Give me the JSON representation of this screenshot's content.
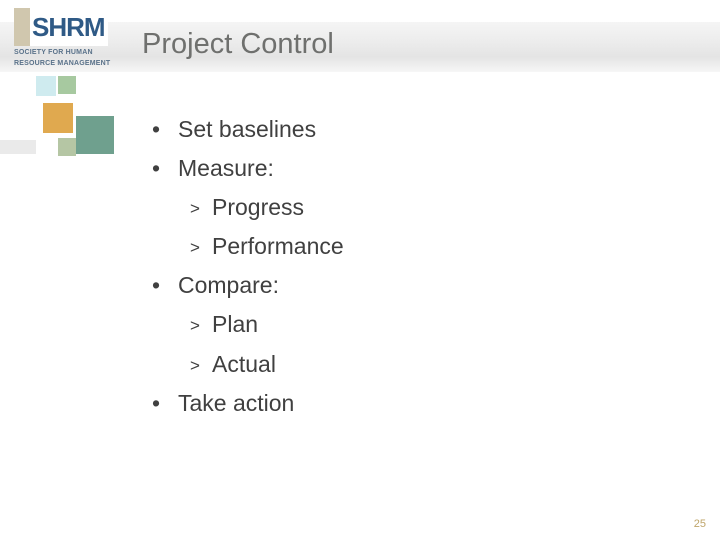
{
  "logo": {
    "letters": "SHRM",
    "sub_line1": "SOCIETY FOR HUMAN",
    "sub_line2": "RESOURCE MANAGEMENT"
  },
  "slide": {
    "title": "Project Control",
    "bullets": {
      "b1": "Set baselines",
      "b2": "Measure:",
      "b2a": "Progress",
      "b2b": "Performance",
      "b3": "Compare:",
      "b3a": "Plan",
      "b3b": "Actual",
      "b4": "Take action"
    },
    "page_number": "25"
  }
}
